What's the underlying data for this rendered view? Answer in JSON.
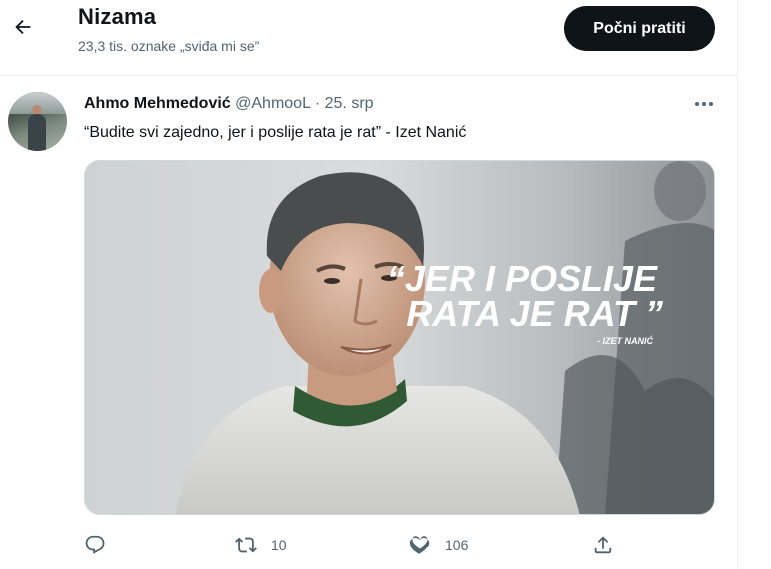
{
  "header": {
    "title": "Nizama",
    "subtitle": "23,3 tis. oznake „sviđa mi se”",
    "follow_label": "Počni pratiti"
  },
  "tweet": {
    "author_name": "Ahmo Mehmedović",
    "handle": "@AhmooL",
    "separator": "·",
    "date": "25. srp",
    "text": "“Budite svi zajedno, jer i poslije rata je rat” - Izet Nanić",
    "image": {
      "quote_line1": "“JER I POSLIJE",
      "quote_line2": "RATA JE RAT ”",
      "attribution": "- IZET NANIĆ"
    },
    "actions": {
      "reply_count": "",
      "retweet_count": "10",
      "like_count": "106"
    }
  },
  "colors": {
    "text_primary": "#0f1419",
    "text_secondary": "#536471",
    "follow_button_bg": "#0f1419",
    "border": "#eff3f4"
  },
  "icons": {
    "back": "arrow-left-icon",
    "more": "more-horizontal-icon",
    "reply": "reply-icon",
    "retweet": "retweet-icon",
    "like": "heart-icon",
    "share": "share-icon"
  }
}
